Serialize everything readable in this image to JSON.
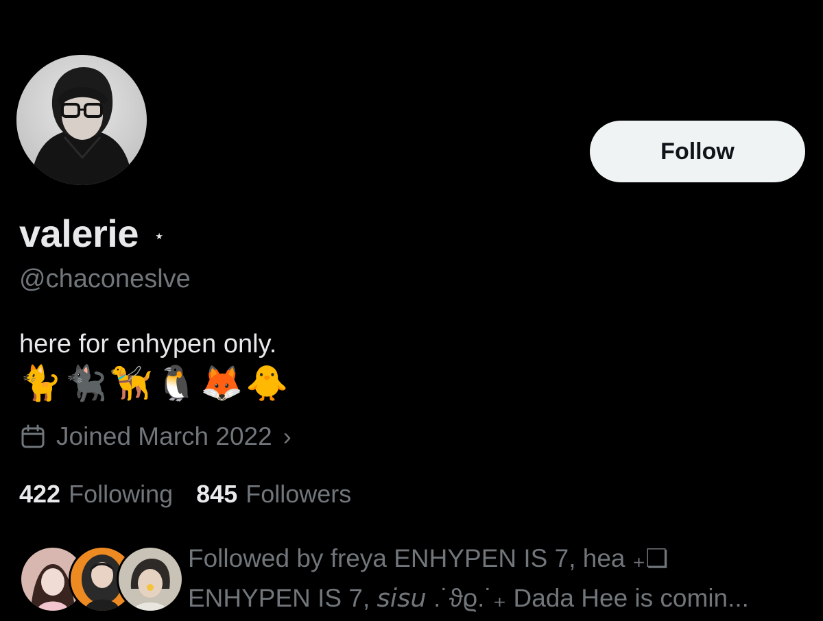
{
  "profile": {
    "display_name": "valerie",
    "name_suffix": "⋆",
    "handle": "@chaconeslve",
    "bio": "here for enhypen only.",
    "bio_emojis": [
      "🐈",
      "🐈‍⬛",
      "🦮",
      "🐧",
      "🦊",
      "🐥"
    ],
    "joined": "Joined March 2022",
    "joined_chevron": "›"
  },
  "actions": {
    "follow_label": "Follow"
  },
  "stats": {
    "following_count": "422",
    "following_label": "Following",
    "followers_count": "845",
    "followers_label": "Followers"
  },
  "followed_by": {
    "line1": "Followed by freya ENHYPEN IS 7, hea ₊❏",
    "line2": "ENHYPEN IS 7, 𝘴𝘪𝘴𝘶 .˙ϑϱ.˙₊ Dada Hee is comin..."
  },
  "colors": {
    "background": "#000000",
    "primary_text": "#e7e9ea",
    "secondary_text": "#71767b",
    "follow_button_bg": "#eff3f4"
  },
  "icons": {
    "joined": "calendar-icon",
    "chevron": "chevron-right-icon"
  }
}
